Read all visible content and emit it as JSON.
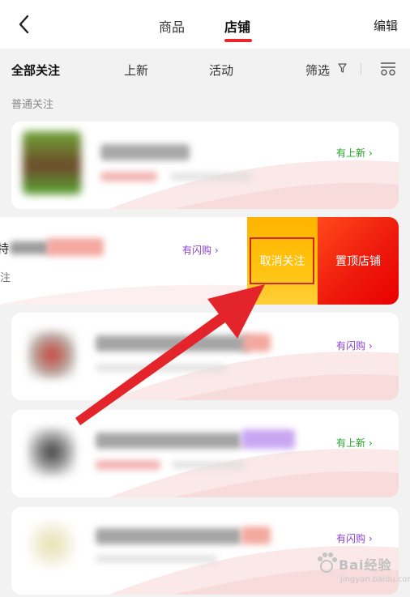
{
  "header": {
    "tabs": [
      {
        "label": "商品",
        "active": false
      },
      {
        "label": "店铺",
        "active": true
      }
    ],
    "edit_label": "编辑"
  },
  "filter_bar": {
    "tabs": [
      {
        "label": "全部关注",
        "active": true
      },
      {
        "label": "上新",
        "active": false
      },
      {
        "label": "活动",
        "active": false
      }
    ],
    "filter_label": "筛选"
  },
  "section_label": "普通关注",
  "stores": [
    {
      "badge": "有上新 ›",
      "badge_color": "#26a52a"
    },
    {
      "title_fragment": "特",
      "subtitle_fragment": "注",
      "badge": "有闪购 ›",
      "badge_color": "#8c3fd4"
    },
    {
      "badge": "有闪购 ›",
      "badge_color": "#8c3fd4"
    },
    {
      "badge": "有上新 ›",
      "badge_color": "#26a52a"
    },
    {
      "badge": "有闪购 ›",
      "badge_color": "#8c3fd4"
    }
  ],
  "swipe_actions": {
    "unfollow_label": "取消关注",
    "pin_label": "置顶店铺"
  },
  "watermark": {
    "text": "Bai经验",
    "sub": "jingyan.baidu.com"
  },
  "colors": {
    "accent": "#e8262b",
    "unfollow_button": "#ffbf00",
    "pin_button": "#f01508",
    "arrow": "#e3242b"
  }
}
